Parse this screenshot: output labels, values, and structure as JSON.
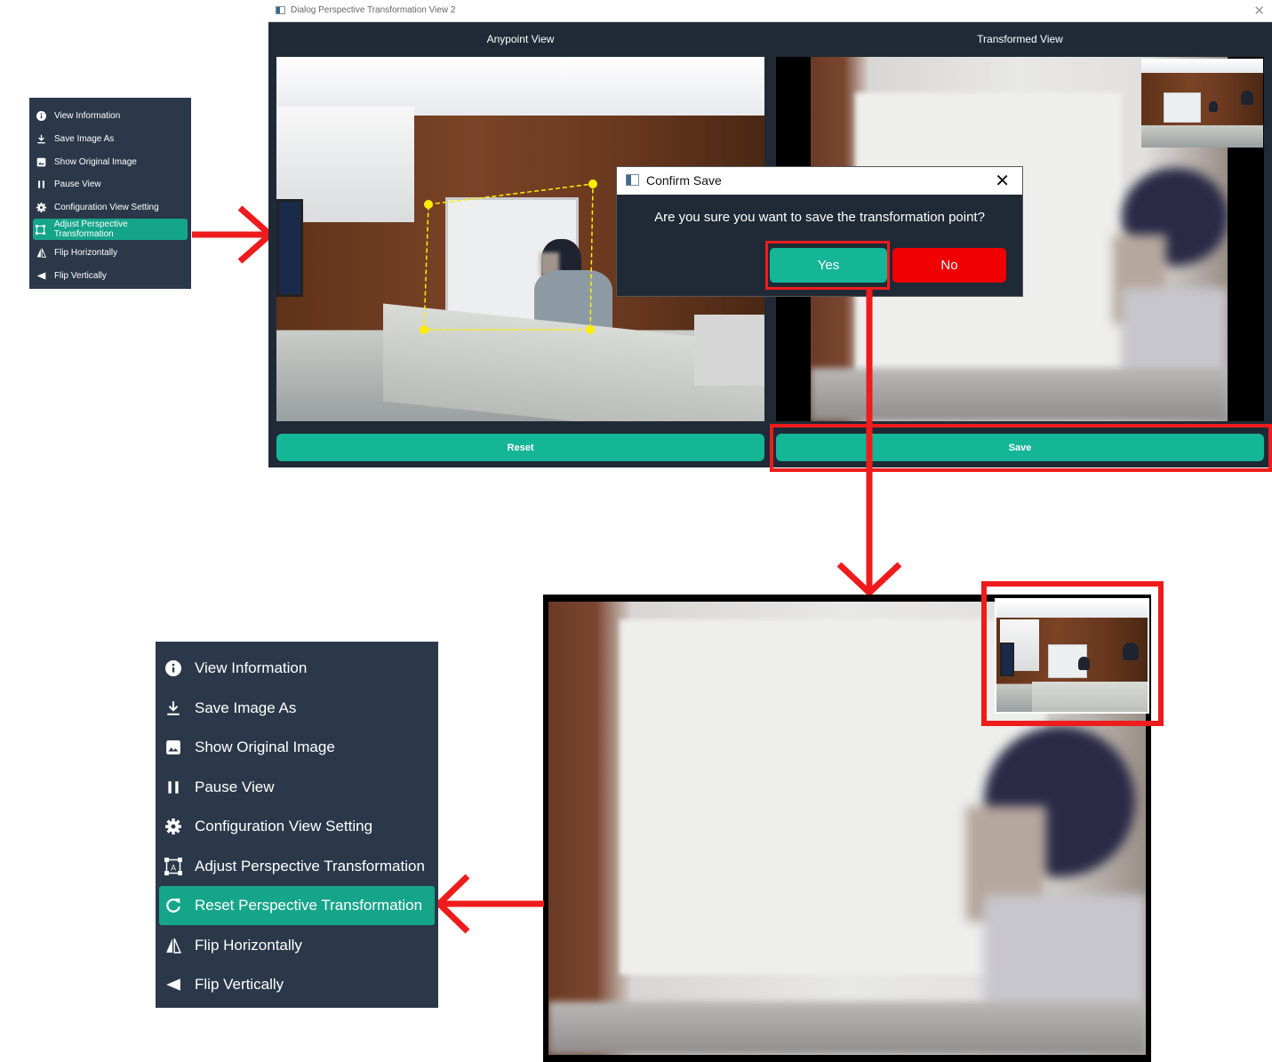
{
  "small_menu": {
    "items": [
      {
        "label": "View Information",
        "icon": "info-icon"
      },
      {
        "label": "Save Image As",
        "icon": "download-icon"
      },
      {
        "label": "Show Original Image",
        "icon": "image-icon"
      },
      {
        "label": "Pause View",
        "icon": "pause-icon"
      },
      {
        "label": "Configuration View Setting",
        "icon": "gear-icon"
      },
      {
        "label": "Adjust Perspective Transformation",
        "icon": "perspective-icon",
        "active": true
      },
      {
        "label": "Flip Horizontally",
        "icon": "flip-horizontal-icon"
      },
      {
        "label": "Flip Vertically",
        "icon": "flip-vertical-icon"
      }
    ]
  },
  "dialog": {
    "title": "Dialog Perspective Transformation View 2",
    "left_label": "Anypoint View",
    "right_label": "Transformed View",
    "reset_label": "Reset",
    "save_label": "Save"
  },
  "confirm": {
    "title": "Confirm Save",
    "message": "Are you sure you want to save the transformation point?",
    "yes_label": "Yes",
    "no_label": "No"
  },
  "large_menu": {
    "items": [
      {
        "label": "View Information",
        "icon": "info-icon"
      },
      {
        "label": "Save Image As",
        "icon": "download-icon"
      },
      {
        "label": "Show Original Image",
        "icon": "image-icon"
      },
      {
        "label": "Pause View",
        "icon": "pause-icon"
      },
      {
        "label": "Configuration View Setting",
        "icon": "gear-icon"
      },
      {
        "label": "Adjust Perspective Transformation",
        "icon": "perspective-icon"
      },
      {
        "label": "Reset Perspective Transformation",
        "icon": "reset-icon",
        "active": true
      },
      {
        "label": "Flip Horizontally",
        "icon": "flip-horizontal-icon"
      },
      {
        "label": "Flip Vertically",
        "icon": "flip-vertical-icon"
      }
    ]
  },
  "colors": {
    "menu_bg": "#2b3849",
    "accent_teal": "#15b597",
    "active_item": "#15a58a",
    "annotation_red": "#ee1c1c",
    "no_button": "#f00000",
    "selection_yellow": "#ffee00"
  }
}
